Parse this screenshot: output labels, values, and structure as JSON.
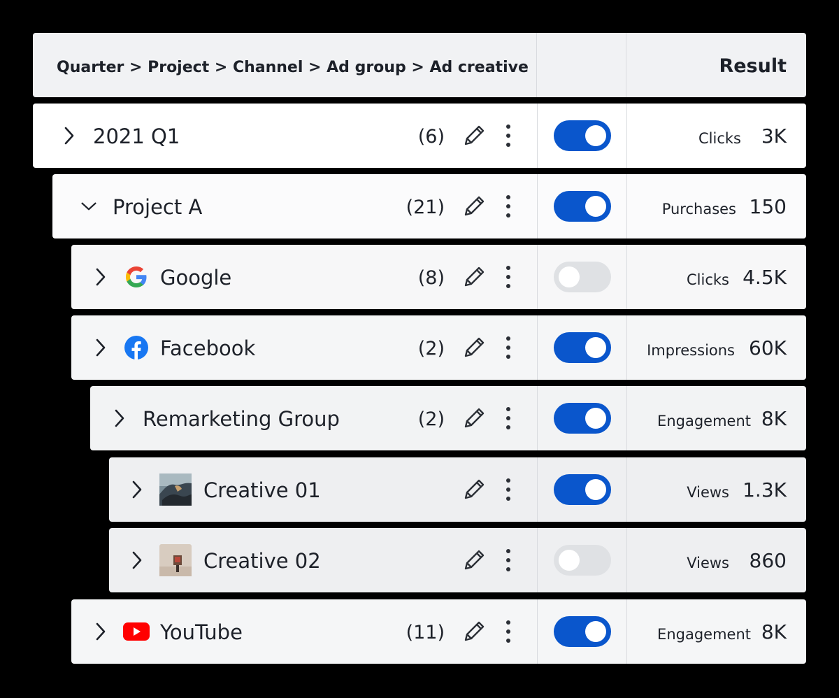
{
  "header": {
    "breadcrumb": "Quarter > Project > Channel > Ad group > Ad creative",
    "result_title": "Result"
  },
  "colors": {
    "toggle_on": "#0a56cc",
    "toggle_off": "#dfe1e4",
    "row_background": "#ffffff",
    "header_background": "#f1f2f4"
  },
  "rows": [
    {
      "name": "2021 Q1",
      "count": "(6)",
      "expanded": false,
      "icon": "",
      "enabled": true,
      "metric": "Clicks",
      "value": "3K"
    },
    {
      "name": "Project A",
      "count": "(21)",
      "expanded": true,
      "icon": "",
      "enabled": true,
      "metric": "Purchases",
      "value": "150"
    },
    {
      "name": "Google",
      "count": "(8)",
      "expanded": false,
      "icon": "google-icon",
      "enabled": false,
      "metric": "Clicks",
      "value": "4.5K"
    },
    {
      "name": "Facebook",
      "count": "(2)",
      "expanded": false,
      "icon": "facebook-icon",
      "enabled": true,
      "metric": "Impressions",
      "value": "60K"
    },
    {
      "name": "Remarketing Group",
      "count": "(2)",
      "expanded": false,
      "icon": "",
      "enabled": true,
      "metric": "Engagement",
      "value": "8K"
    },
    {
      "name": "Creative 01",
      "count": "",
      "expanded": false,
      "icon": "creative-thumbnail-landscape",
      "enabled": true,
      "metric": "Views",
      "value": "1.3K"
    },
    {
      "name": "Creative 02",
      "count": "",
      "expanded": false,
      "icon": "creative-thumbnail-room",
      "enabled": false,
      "metric": "Views",
      "value": "860"
    },
    {
      "name": "YouTube",
      "count": "(11)",
      "expanded": false,
      "icon": "youtube-icon",
      "enabled": true,
      "metric": "Engagement",
      "value": "8K"
    }
  ]
}
